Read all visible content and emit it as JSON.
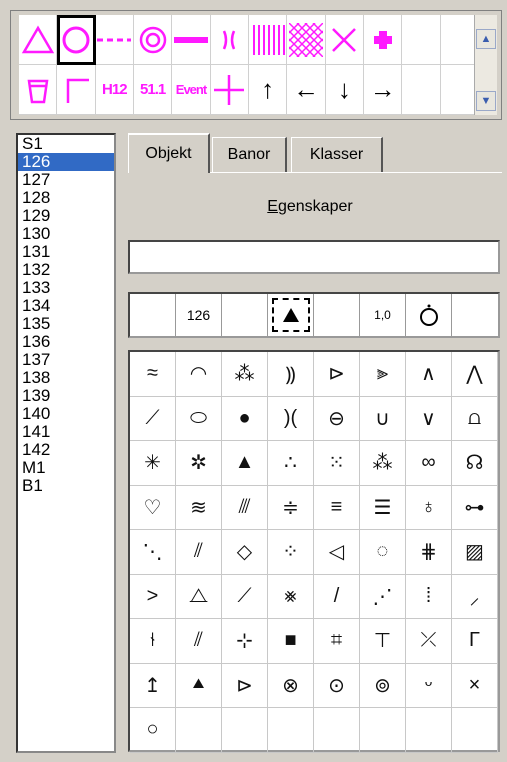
{
  "palette": {
    "row1": [
      {
        "icon": "triangle-icon"
      },
      {
        "icon": "circle-icon",
        "selected": true
      },
      {
        "icon": "dashed-line-icon"
      },
      {
        "icon": "double-circle-icon"
      },
      {
        "icon": "thick-line-icon"
      },
      {
        "icon": "bracket-icon"
      },
      {
        "icon": "vertical-hatch-icon"
      },
      {
        "icon": "cross-hatch-icon"
      },
      {
        "icon": "x-mark-icon"
      },
      {
        "icon": "plus-filled-icon"
      }
    ],
    "row2": [
      {
        "icon": "cup-icon"
      },
      {
        "icon": "corner-icon"
      },
      {
        "text": "H12"
      },
      {
        "text": "51.1"
      },
      {
        "text": "Event"
      },
      {
        "icon": "cross-icon"
      },
      {
        "icon": "arrow-up-icon",
        "glyph": "↑"
      },
      {
        "icon": "arrow-left-icon",
        "glyph": "←"
      },
      {
        "icon": "arrow-down-icon",
        "glyph": "↓"
      },
      {
        "icon": "arrow-right-icon",
        "glyph": "→"
      }
    ],
    "color": "#ff1aff"
  },
  "list": {
    "items": [
      "S1",
      "126",
      "127",
      "128",
      "129",
      "130",
      "131",
      "132",
      "133",
      "134",
      "135",
      "136",
      "137",
      "138",
      "139",
      "140",
      "141",
      "142",
      "M1",
      "B1"
    ],
    "selected": "126"
  },
  "tabs": [
    {
      "label": "Objekt",
      "active": true
    },
    {
      "label": "Banor",
      "active": false
    },
    {
      "label": "Klasser",
      "active": false
    }
  ],
  "properties": {
    "label_first": "E",
    "label_rest": "genskaper",
    "name_value": ""
  },
  "attributes": {
    "code": "126",
    "scale": "1,0"
  },
  "symbols": [
    "≈",
    "◠",
    "⁂",
    "⸩",
    "⊳",
    "⫸",
    "∧",
    "⋀",
    "⟋",
    "⬭",
    "●",
    ")(",
    "⊖",
    "∪",
    "∨",
    "⩍",
    "✳",
    "✲",
    "▲",
    "∴",
    "⁙",
    "⁂",
    "∞",
    "☊",
    "♡",
    "≋",
    "⫻",
    "≑",
    "≡",
    "☰",
    "♁",
    "⊶",
    "⋱",
    "⫽",
    "◇",
    "⁘",
    "◁",
    "◌",
    "⋕",
    "▨",
    ">",
    "⧍",
    "⟋",
    "⨳",
    "/",
    "⋰",
    "⁞",
    "⸝",
    "⫮",
    "⫽",
    "⊹",
    "■",
    "⌗",
    "⊤",
    "⤫",
    "Γ",
    "↥",
    "⯅",
    "⊳",
    "⊗",
    "⊙",
    "⊚",
    "ᵕ",
    "×",
    "○",
    "",
    "",
    "",
    "",
    "",
    "",
    ""
  ]
}
